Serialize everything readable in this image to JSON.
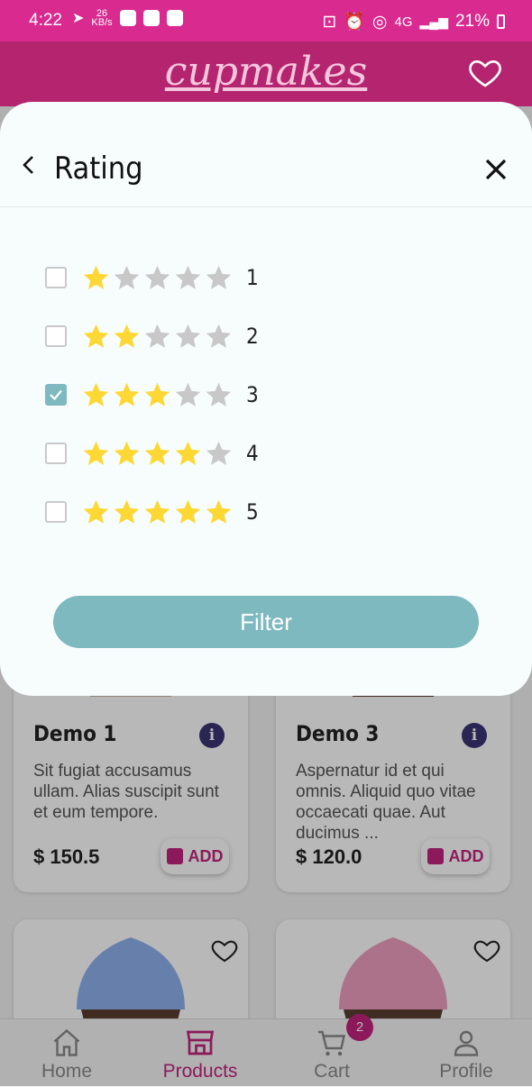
{
  "status": {
    "time": "4:22",
    "net_speed": "26",
    "net_unit": "KB/s",
    "signal_label": "4G",
    "battery": "21%"
  },
  "app": {
    "brand": "cupmakes"
  },
  "modal": {
    "title": "Rating",
    "filter_label": "Filter",
    "options": [
      {
        "value": "1",
        "stars": 1,
        "checked": false
      },
      {
        "value": "2",
        "stars": 2,
        "checked": false
      },
      {
        "value": "3",
        "stars": 3,
        "checked": true
      },
      {
        "value": "4",
        "stars": 4,
        "checked": false
      },
      {
        "value": "5",
        "stars": 5,
        "checked": false
      }
    ]
  },
  "products": [
    {
      "title": "Demo 1",
      "desc": " Sit fugiat accusamus ullam. Alias suscipit sunt et eum tempore.",
      "price": "$ 150.5",
      "add_label": "ADD"
    },
    {
      "title": "Demo 3",
      "desc": " Aspernatur id et qui omnis. Aliquid quo vitae occaecati quae. Aut ducimus ...",
      "price": "$ 120.0",
      "add_label": "ADD"
    }
  ],
  "nav": {
    "home": "Home",
    "products": "Products",
    "cart": "Cart",
    "profile": "Profile",
    "cart_count": "2"
  },
  "colors": {
    "status_bar": "#d92a8f",
    "header": "#b5256f",
    "accent": "#c2257e",
    "teal": "#7eb9bf",
    "star_on": "#fdd835",
    "star_off": "#c8c8c8"
  }
}
